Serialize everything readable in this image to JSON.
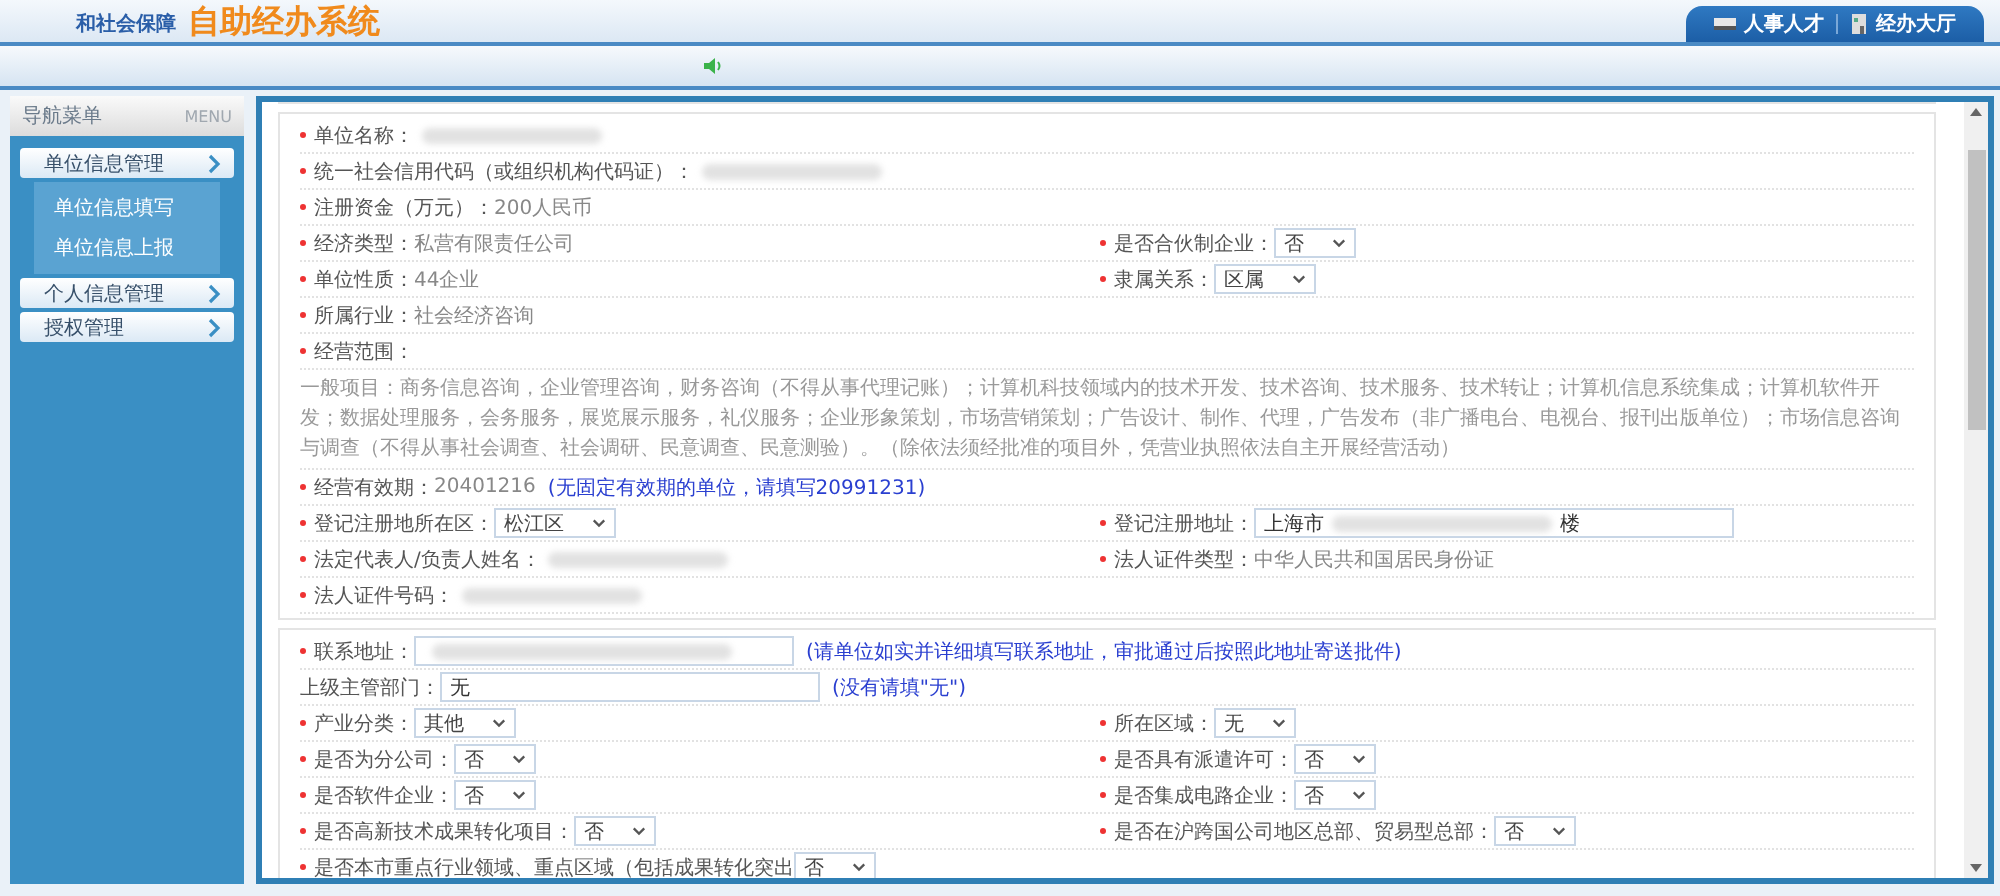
{
  "header": {
    "subtitle": "和社会保障",
    "title": "自助经办系统",
    "tabs": [
      {
        "label": "人事人才"
      },
      {
        "label": "经办大厅"
      }
    ]
  },
  "sidebar": {
    "heading": "导航菜单",
    "heading_en": "MENU",
    "groups": [
      {
        "label": "单位信息管理",
        "children": [
          {
            "label": "单位信息填写"
          },
          {
            "label": "单位信息上报"
          }
        ]
      },
      {
        "label": "个人信息管理"
      },
      {
        "label": "授权管理"
      }
    ]
  },
  "sections": [
    {
      "rows": [
        {
          "left": {
            "kind": "redacted",
            "label": "单位名称：",
            "required": true
          }
        },
        {
          "left": {
            "kind": "redacted",
            "label": "统一社会信用代码（或组织机构代码证）：",
            "required": true
          }
        },
        {
          "left": {
            "kind": "text",
            "label": "注册资金（万元）：",
            "required": true,
            "value": "200人民币"
          }
        },
        {
          "left": {
            "kind": "text",
            "label": "经济类型：",
            "required": true,
            "value": "私营有限责任公司"
          },
          "right": {
            "kind": "select",
            "label": "是否合伙制企业：",
            "required": true,
            "value": "否"
          }
        },
        {
          "left": {
            "kind": "text",
            "label": "单位性质：",
            "required": true,
            "value": "44企业"
          },
          "right": {
            "kind": "select",
            "label": "隶属关系：",
            "required": true,
            "value": "区属"
          }
        },
        {
          "left": {
            "kind": "text",
            "label": "所属行业：",
            "required": true,
            "value": "社会经济咨询"
          }
        },
        {
          "left": {
            "kind": "text",
            "label": "经营范围：",
            "required": true
          }
        },
        {
          "left": {
            "kind": "paragraph",
            "text": "一般项目：商务信息咨询，企业管理咨询，财务咨询（不得从事代理记账）；计算机科技领域内的技术开发、技术咨询、技术服务、技术转让；计算机信息系统集成；计算机软件开发；数据处理服务，会务服务，展览展示服务，礼仪服务；企业形象策划，市场营销策划；广告设计、制作、代理，广告发布（非广播电台、电视台、报刊出版单位）；市场信息咨询与调查（不得从事社会调查、社会调研、民意调查、民意测验）。（除依法须经批准的项目外，凭营业执照依法自主开展经营活动）"
          }
        },
        {
          "left": {
            "kind": "text",
            "label": "经营有效期：",
            "required": true,
            "value": "20401216",
            "note": "(无固定有效期的单位，请填写20991231)"
          }
        },
        {
          "left": {
            "kind": "select",
            "label": "登记注册地所在区：",
            "required": true,
            "value": "松江区"
          },
          "right": {
            "kind": "input",
            "label": "登记注册地址：",
            "required": true,
            "value": "上海市",
            "value_end": "楼"
          }
        },
        {
          "left": {
            "kind": "redacted",
            "label": "法定代表人/负责人姓名：",
            "required": true
          },
          "right": {
            "kind": "text",
            "label": "法人证件类型：",
            "required": true,
            "value": "中华人民共和国居民身份证"
          }
        },
        {
          "left": {
            "kind": "redacted",
            "label": "法人证件号码：",
            "required": true
          }
        }
      ]
    },
    {
      "rows": [
        {
          "left": {
            "kind": "input",
            "label": "联系地址：",
            "required": true,
            "note": "(请单位如实并详细填写联系地址，审批通过后按照此地址寄送批件)"
          }
        },
        {
          "left": {
            "kind": "input",
            "label": "上级主管部门：",
            "required": false,
            "value": "无",
            "note": "(没有请填\"无\")"
          }
        },
        {
          "left": {
            "kind": "select",
            "label": "产业分类：",
            "required": true,
            "value": "其他"
          },
          "right": {
            "kind": "select",
            "label": "所在区域：",
            "required": true,
            "value": "无"
          }
        },
        {
          "left": {
            "kind": "select",
            "label": "是否为分公司：",
            "required": true,
            "value": "否"
          },
          "right": {
            "kind": "select",
            "label": "是否具有派遣许可：",
            "required": true,
            "value": "否"
          }
        },
        {
          "left": {
            "kind": "select",
            "label": "是否软件企业：",
            "required": true,
            "value": "否"
          },
          "right": {
            "kind": "select",
            "label": "是否集成电路企业：",
            "required": true,
            "value": "否"
          }
        },
        {
          "left": {
            "kind": "select",
            "label": "是否高新技术成果转化项目：",
            "required": true,
            "value": "否"
          },
          "right": {
            "kind": "select",
            "label": "是否在沪跨国公司地区总部、贸易型总部：",
            "required": true,
            "value": "否"
          }
        },
        {
          "left": {
            "kind": "select",
            "label": "是否本市重点行业领域、重点区域（包括成果转化突出",
            "required": true,
            "value": "否"
          }
        }
      ]
    }
  ]
}
